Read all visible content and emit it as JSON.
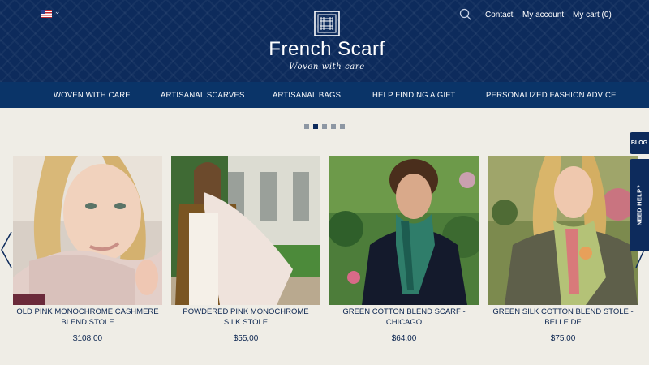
{
  "header": {
    "language_flag": "us-flag-icon",
    "brand": "French Scarf",
    "tagline": "Woven with care",
    "links": {
      "contact": "Contact",
      "account": "My account",
      "cart": "My cart (0)"
    }
  },
  "nav": {
    "items": [
      "WOVEN WITH CARE",
      "ARTISANAL SCARVES",
      "ARTISANAL BAGS",
      "HELP FINDING A GIFT",
      "PERSONALIZED FASHION ADVICE"
    ]
  },
  "carousel": {
    "dots": 5,
    "active_dot": 1
  },
  "products": [
    {
      "name": "OLD PINK MONOCHROME CASHMERE BLEND STOLE",
      "price": "$108,00",
      "image": "woman in pink cashmere stole"
    },
    {
      "name": "POWDERED PINK MONOCHROME SILK STOLE",
      "price": "$55,00",
      "image": "woman in powdered pink silk stole"
    },
    {
      "name": "GREEN COTTON BLEND SCARF - CHICAGO",
      "price": "$64,00",
      "image": "man in green cotton scarf"
    },
    {
      "name": "GREEN SILK COTTON BLEND STOLE - BELLE DE",
      "price": "$75,00",
      "image": "woman in green silk stole"
    }
  ],
  "side_tabs": {
    "blog": "BLOG",
    "help": "NEED HELP?"
  },
  "colors": {
    "header_bg": "#0d2b5c",
    "nav_bg": "#0a3468",
    "page_bg": "#efede6",
    "text": "#0b2550"
  }
}
